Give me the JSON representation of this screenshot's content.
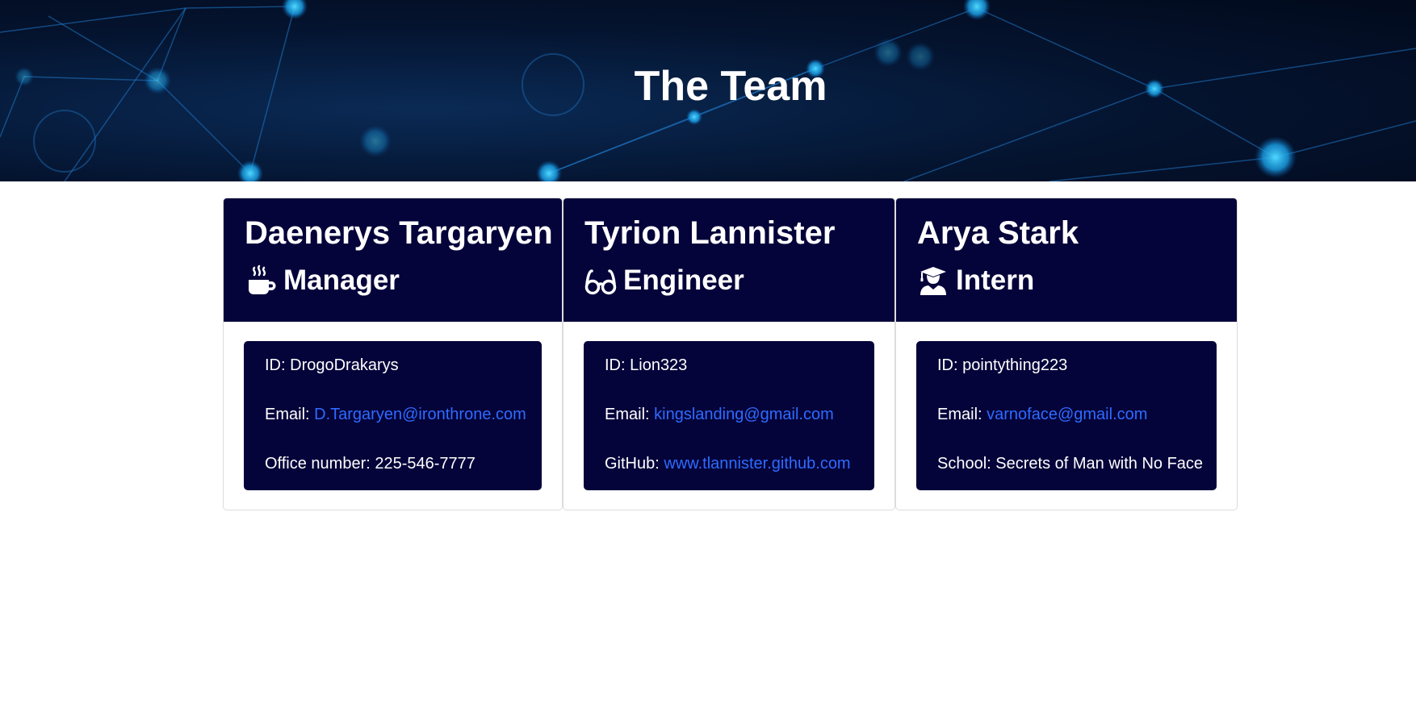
{
  "header": {
    "title": "The Team"
  },
  "colors": {
    "card_bg": "#04033a",
    "link": "#2f6bff",
    "text": "#ffffff"
  },
  "cards": [
    {
      "name": "Daenerys Targaryen",
      "role": "Manager",
      "role_icon": "mug-hot-icon",
      "id_label": "ID:",
      "id_value": "DrogoDrakarys",
      "email_label": "Email:",
      "email_value": "D.Targaryen@ironthrone.com",
      "extra_label": "Office number:",
      "extra_value": "225-546-7777"
    },
    {
      "name": "Tyrion Lannister",
      "role": "Engineer",
      "role_icon": "glasses-icon",
      "id_label": "ID:",
      "id_value": "Lion323",
      "email_label": "Email:",
      "email_value": "kingslanding@gmail.com",
      "extra_label": "GitHub:",
      "extra_value": "www.tlannister.github.com"
    },
    {
      "name": "Arya Stark",
      "role": "Intern",
      "role_icon": "user-graduate-icon",
      "id_label": "ID:",
      "id_value": "pointything223",
      "email_label": "Email:",
      "email_value": "varnoface@gmail.com",
      "extra_label": "School:",
      "extra_value": "Secrets of Man with No Face"
    }
  ]
}
